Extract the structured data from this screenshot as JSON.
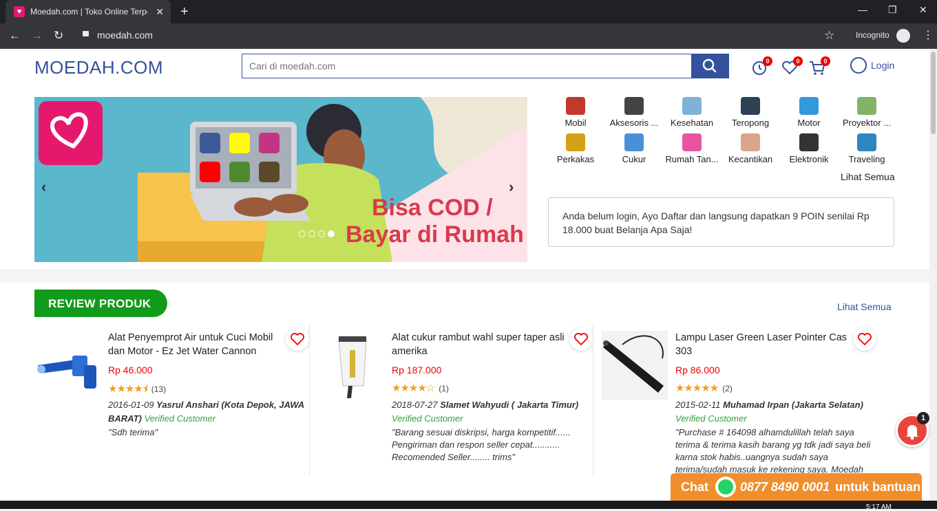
{
  "browser": {
    "tab_title": "Moedah.com | Toko Online Terpe",
    "url": "moedah.com",
    "incognito_label": "Incognito",
    "close": "✕",
    "newtab": "+",
    "minimize": "—",
    "maximize": "❐",
    "winclose": "✕",
    "back": "←",
    "forward": "→",
    "reload": "↻",
    "star": "☆",
    "menu": "⋮"
  },
  "header": {
    "logo": "MOEDAH.COM",
    "search_placeholder": "Cari di moedah.com",
    "history_count": "0",
    "wishlist_count": "0",
    "cart_count": "0",
    "login_label": "Login"
  },
  "banner": {
    "headline_line1": "Bisa COD /",
    "headline_line2": "Bayar di Rumah",
    "prev": "‹",
    "next": "›",
    "slides": 4,
    "active_slide": 4
  },
  "categories": [
    {
      "label": "Mobil",
      "icon": "car-steering-icon",
      "color": "#c0392b"
    },
    {
      "label": "Aksesoris ...",
      "icon": "tripod-icon",
      "color": "#444444"
    },
    {
      "label": "Kesehatan",
      "icon": "syringe-icon",
      "color": "#7fb3d5"
    },
    {
      "label": "Teropong",
      "icon": "binoculars-icon",
      "color": "#2e4053"
    },
    {
      "label": "Motor",
      "icon": "motor-part-icon",
      "color": "#3498db"
    },
    {
      "label": "Proyektor ...",
      "icon": "projector-icon",
      "color": "#82b366"
    },
    {
      "label": "Perkakas",
      "icon": "drill-icon",
      "color": "#d4a017"
    },
    {
      "label": "Cukur",
      "icon": "razor-icon",
      "color": "#4a90d9"
    },
    {
      "label": "Rumah Tan...",
      "icon": "cleaning-icon",
      "color": "#e754a1"
    },
    {
      "label": "Kecantikan",
      "icon": "face-icon",
      "color": "#d9a48a"
    },
    {
      "label": "Elektronik",
      "icon": "camera-icon",
      "color": "#333333"
    },
    {
      "label": "Traveling",
      "icon": "luggage-icon",
      "color": "#2e86c1"
    }
  ],
  "categories_more": "Lihat Semua",
  "login_notice": "Anda belum login, Ayo Daftar dan langsung dapatkan 9 POIN senilai Rp 18.000 buat Belanja Apa Saja!",
  "reviews": {
    "title": "REVIEW PRODUK",
    "more": "Lihat Semua",
    "items": [
      {
        "name": "Alat Penyemprot Air untuk Cuci Mobil dan Motor - Ez Jet Water Cannon",
        "price": "Rp 46.000",
        "stars": "★★★★⯨",
        "rating": 4.5,
        "count": "(13)",
        "date": "2016-01-09",
        "reviewer": "Yasrul Anshari (Kota Depok, JAWA BARAT)",
        "verified": "Verified Customer",
        "quote": "\"Sdh terima\""
      },
      {
        "name": "Alat cukur rambut wahl super taper asli amerika",
        "price": "Rp 187.000",
        "stars": "★★★★☆",
        "rating": 4,
        "count": "(1)",
        "date": "2018-07-27",
        "reviewer": "Slamet Wahyudi ( Jakarta Timur)",
        "verified": "Verified Customer",
        "quote": "\"Barang sesuai diskripsi, harga kompetitif...... Pengiriman dan respon seller cepat........... Recomended Seller........ trims\""
      },
      {
        "name": "Lampu Laser Green Laser Pointer Cas 303",
        "price": "Rp 86.000",
        "stars": "★★★★★",
        "rating": 5,
        "count": "(2)",
        "date": "2015-02-11",
        "reviewer": "Muhamad Irpan (Jakarta Selatan)",
        "verified": "Verified Customer",
        "quote": "\"Purchase # 164098 alhamdulillah telah saya terima & terima kasih barang yg tdk jadi saya beli karna stok habis..uangnya sudah saya terima/sudah masuk ke rekening saya. Moedah"
      }
    ]
  },
  "chat": {
    "label": "Chat",
    "number": "0877 8490 0001",
    "suffix": "untuk bantuan"
  },
  "notification_count": "1",
  "clock": "5:17 AM"
}
